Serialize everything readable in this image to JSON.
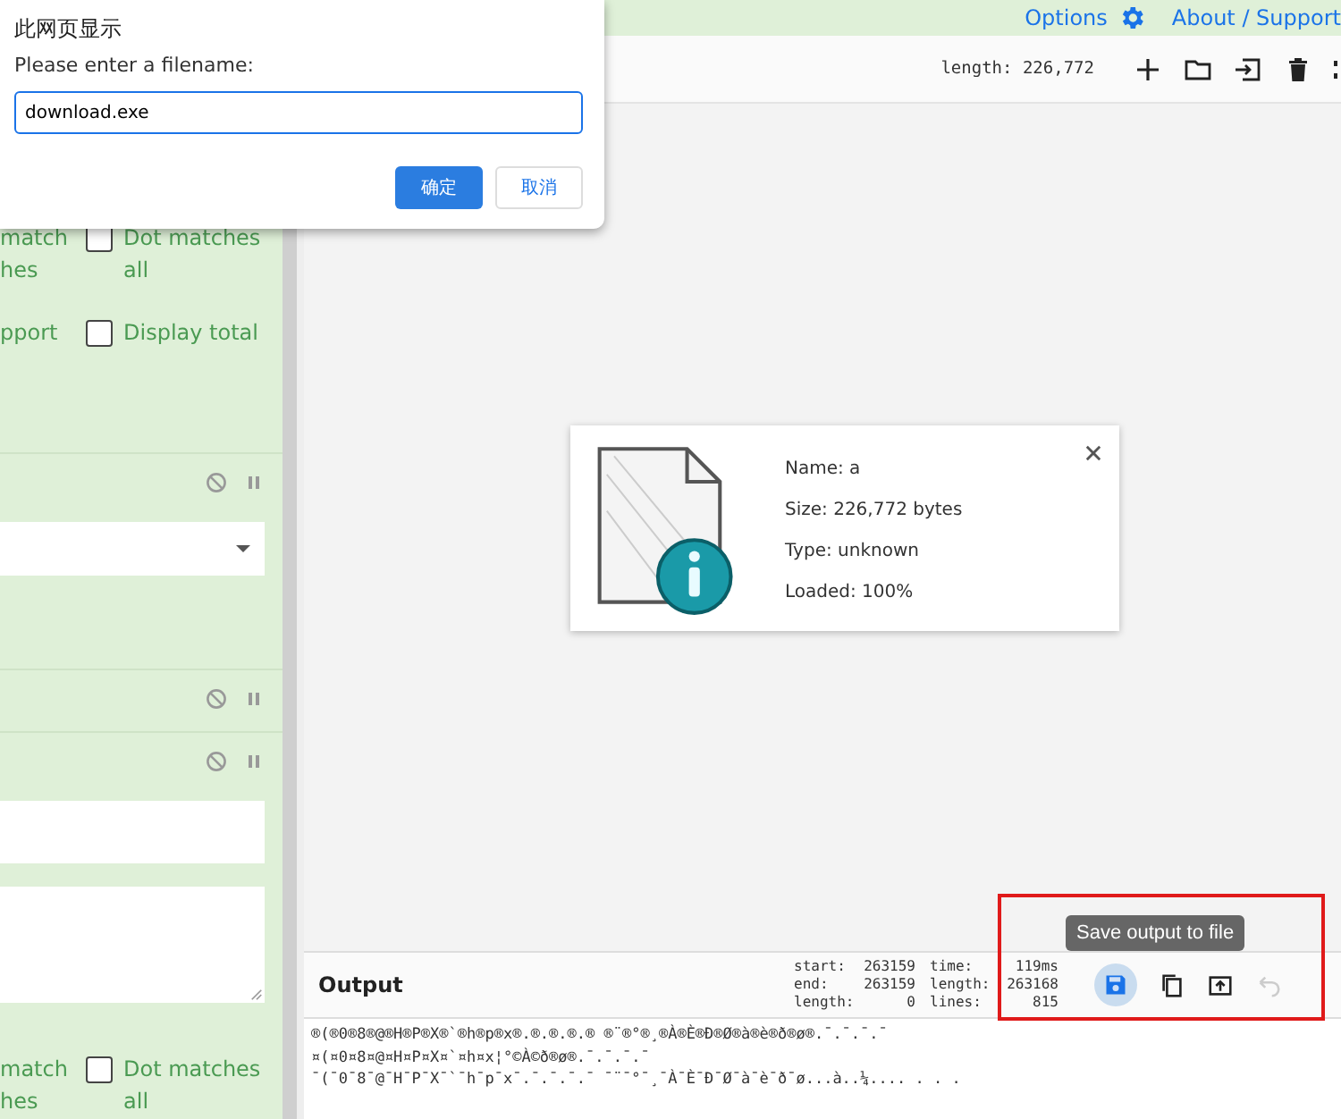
{
  "dialog": {
    "title": "此网页显示",
    "message": "Please enter a filename:",
    "value": "download.exe",
    "buttons": [
      {
        "label": "确定",
        "primary": true
      },
      {
        "label": "取消",
        "primary": false
      }
    ]
  },
  "top_links": [
    {
      "label": "Options",
      "kind": "gear"
    },
    {
      "label": "About / Support",
      "kind": "plain"
    }
  ],
  "upper_options": [
    {
      "cut_text": [
        "match",
        "hes"
      ],
      "checkbox_label": [
        "Dot matches",
        "all"
      ],
      "checked": false
    },
    {
      "cut_text": [
        "pport"
      ],
      "checkbox_label": [
        "Display total"
      ],
      "checked": false
    }
  ],
  "operations": [
    {
      "kind": "dropdown"
    },
    {
      "kind": "plain"
    },
    {
      "kind": "text"
    }
  ],
  "lower_options": [
    {
      "cut_text": [
        "match",
        "hes"
      ],
      "checkbox_label": [
        "Dot matches",
        "all"
      ],
      "checked": false
    }
  ],
  "input": {
    "length": "length: 226,772"
  },
  "file_info": [
    "Name: a",
    "Size: 226,772 bytes",
    "Type: unknown",
    "Loaded: 100%"
  ],
  "output": {
    "title": "Output",
    "stats": [
      {
        "label": "start:",
        "value": "263159"
      },
      {
        "label": "end:",
        "value": "263159"
      },
      {
        "label": "length:",
        "value": "0"
      }
    ],
    "stats2": [
      {
        "label": "time:",
        "value": "119ms"
      },
      {
        "label": "length:",
        "value": "263168"
      },
      {
        "label": "lines:",
        "value": "815"
      }
    ],
    "tooltip": "Save output to file",
    "lines": [
      "®(®0®8®@®H®P®X®`®h®p®x®.®.®.®.® ®¨®°®¸®À®È®Ð®Ø®à®è®ð®ø®.¯.¯.¯.¯",
      "¤(¤0¤8¤@¤H¤P¤X¤`¤h¤x¦°©À©ð®ø®.¯.¯.¯.¯",
      "¯(¯0¯8¯@¯H¯P¯X¯`¯h¯p¯x¯.¯.¯.¯.¯ ¯¨¯°¯¸¯À¯È¯Ð¯Ø¯à¯è¯ð¯ø...à..¼.... . . ."
    ]
  }
}
